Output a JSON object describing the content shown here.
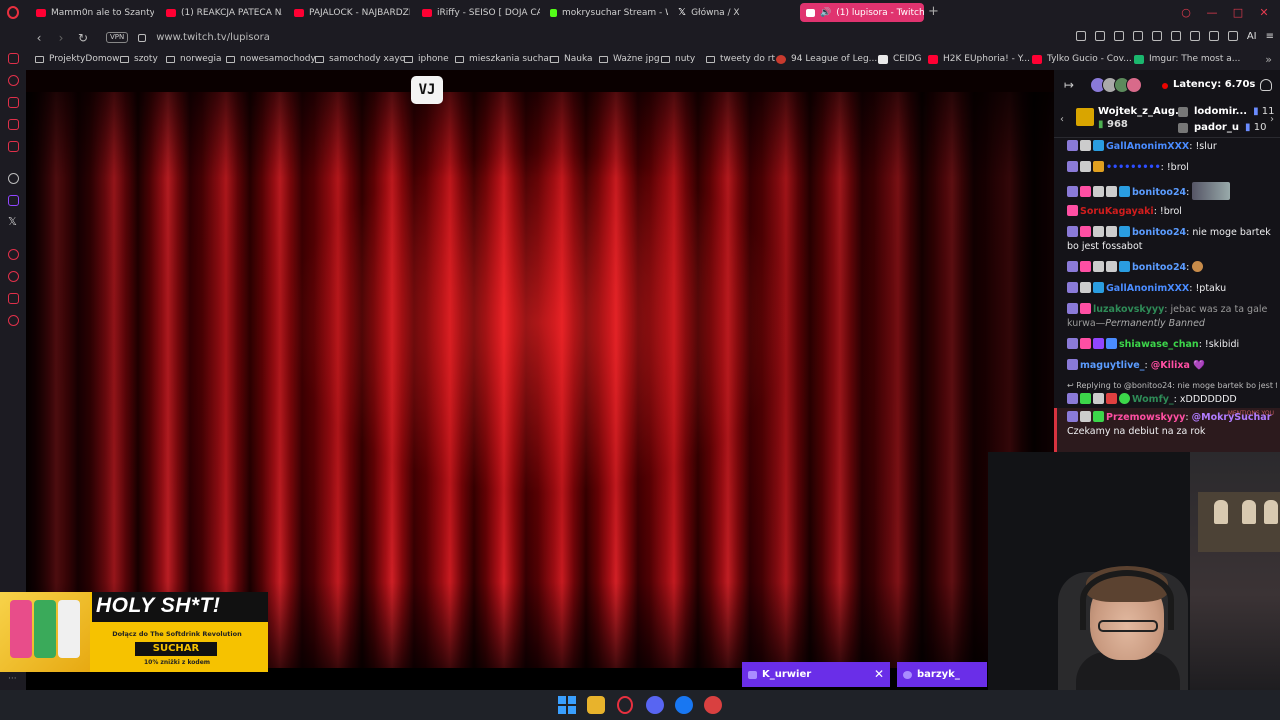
{
  "tabs": [
    {
      "label": "Mamm0n ale to Szanty - Y",
      "color": "#ff0033",
      "active": false
    },
    {
      "label": "(1) REAKCJA PATECA NA",
      "color": "#ff0033",
      "active": false
    },
    {
      "label": "PAJALOCK - NAJBARDZI",
      "color": "#ff0033",
      "active": false
    },
    {
      "label": "iRiffy - SEISO [ DOJA CAT",
      "color": "#ff0033",
      "active": false
    },
    {
      "label": "mokrysuchar Stream - Wa",
      "color": "#53fc18",
      "active": false
    },
    {
      "label": "Główna / X",
      "color": "#ffffff",
      "active": false
    },
    {
      "label": "(1) lupisora - Twitch",
      "color": "#ffffff",
      "active": true
    }
  ],
  "address": {
    "vpn": "VPN",
    "url": "www.twitch.tv/lupisora",
    "ai_label": "AI"
  },
  "bookmarks": [
    {
      "label": "ProjektyDomow",
      "type": "folder"
    },
    {
      "label": "szoty",
      "type": "folder"
    },
    {
      "label": "norwegia",
      "type": "folder"
    },
    {
      "label": "nowesamochody",
      "type": "folder"
    },
    {
      "label": "samochody xayo",
      "type": "folder"
    },
    {
      "label": "iphone",
      "type": "folder"
    },
    {
      "label": "mieszkania suchar",
      "type": "folder"
    },
    {
      "label": "Nauka",
      "type": "folder"
    },
    {
      "label": "Ważne jpg",
      "type": "folder"
    },
    {
      "label": "nuty",
      "type": "folder"
    },
    {
      "label": "tweety do rt",
      "type": "folder"
    },
    {
      "label": "94 League of Leg...",
      "type": "site"
    },
    {
      "label": "CEIDG",
      "type": "site"
    },
    {
      "label": "H2K EUphoria! - Y...",
      "type": "site"
    },
    {
      "label": "Tylko Gucio - Cov...",
      "type": "site"
    },
    {
      "label": "Imgur: The most a...",
      "type": "site"
    }
  ],
  "video": {
    "logo": "VJ"
  },
  "ad": {
    "headline": "HOLY SH*T!",
    "subtext": "Dołącz do The Softdrink Revolution",
    "code": "SUCHAR",
    "discount": "10% zniżki z kodem"
  },
  "chat": {
    "latency": "Latency: 6.70s",
    "gift_top": {
      "name": "Wojtek_z_Aug...",
      "count": "968"
    },
    "leaders": [
      {
        "name": "lodomir...",
        "count": "11"
      },
      {
        "name": "pador_u",
        "count": "10"
      }
    ],
    "messages": [
      {
        "user": "GallAnonimXXX",
        "color": "#4a8cff",
        "text": ": !slur"
      },
      {
        "user": "",
        "color": "#2d4dff",
        "text": ": !brol"
      },
      {
        "user": "bonitoo24",
        "color": "#5b9cff",
        "text": ": "
      },
      {
        "user": "SoruKagayaki",
        "color": "#d11d1d",
        "text": ": !brol"
      },
      {
        "user": "bonitoo24",
        "color": "#5b9cff",
        "text": ": nie moge bartek bo jest fossabot"
      },
      {
        "user": "bonitoo24",
        "color": "#5b9cff",
        "text": ": "
      },
      {
        "user": "GallAnonimXXX",
        "color": "#4a8cff",
        "text": ": !ptaku"
      },
      {
        "user": "luzakovskyyy",
        "color": "#2e8b57",
        "text": ": jebac was za ta gale kurwa",
        "banned": "—Permanently Banned"
      },
      {
        "user": "shiawase_chan",
        "color": "#3cd64a",
        "text": ": !skibidi"
      },
      {
        "user": "maguytlive_",
        "color": "#5b9cff",
        "text": ": ",
        "mention": "@Kilixa",
        "heart": "💜"
      },
      {
        "reply": "Replying to @bonitoo24: nie moge bartek bo jest f"
      },
      {
        "user": "Womfy_",
        "color": "#2e8b57",
        "text": ": xDDDDDDD"
      },
      {
        "user": "Przemowskyyy",
        "color": "#ff4fa3",
        "mention": "@MokrySuchar",
        "text2": "Czekamy na debiut na za rok",
        "mentions_you": "MENTIONS YOU"
      }
    ]
  },
  "popups": [
    {
      "user": "K_urwier",
      "close": "✕"
    },
    {
      "user": "barzyk_"
    }
  ]
}
